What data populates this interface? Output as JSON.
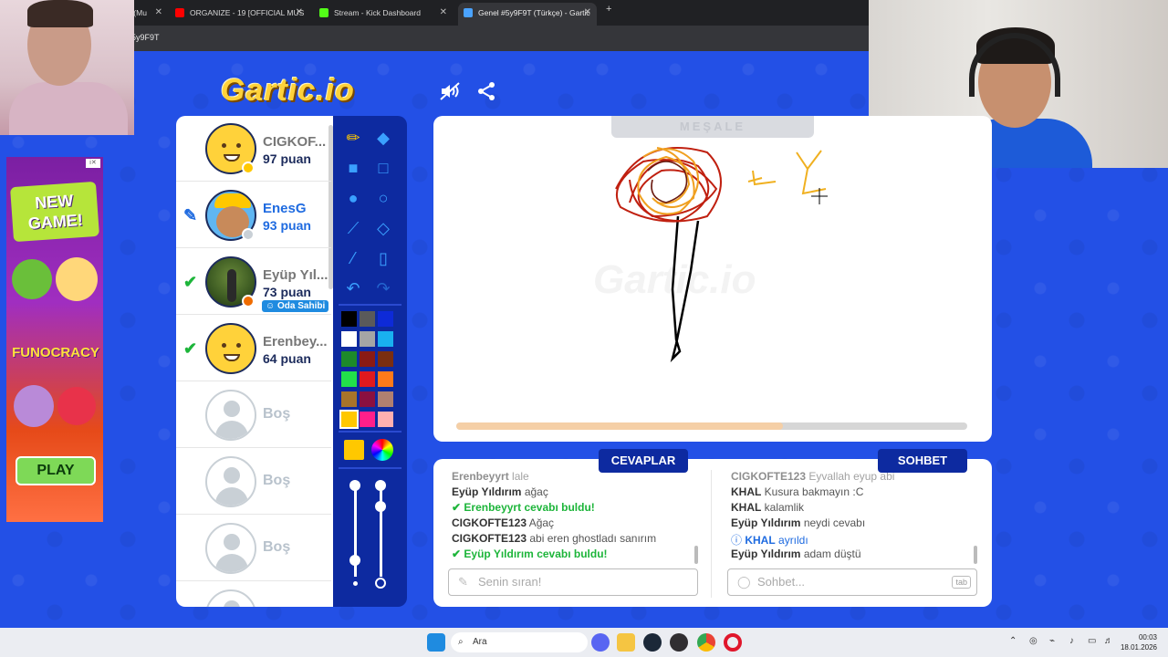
{
  "browser": {
    "tabs": [
      {
        "label": "YE BOYUN (Mu",
        "active": false,
        "favicon_color": "#d93025"
      },
      {
        "label": "ORGANIZE - 19 [OFFICIAL MUS",
        "active": false,
        "favicon_color": "#ff0000"
      },
      {
        "label": "Stream - Kick Dashboard",
        "active": false,
        "favicon_color": "#53fc18"
      },
      {
        "label": "Genel #5y9F9T (Türkçe) - Gartic",
        "active": true,
        "favicon_color": "#4aa3ff"
      }
    ],
    "url": "gartic.io/055y9F9T"
  },
  "logo": "Gartic.io",
  "players": [
    {
      "name": "CIGKOF...",
      "score": "97 puan",
      "avatar": "yellow",
      "status_color": "#ffc800",
      "mark": ""
    },
    {
      "name": "EnesG",
      "score": "93 puan",
      "avatar": "boy",
      "status_color": "#c9d0d6",
      "mark": "pencil",
      "is_drawer": true
    },
    {
      "name": "Eyüp Yıl...",
      "score": "73 puan",
      "avatar": "photo",
      "status_color": "#ef6c00",
      "mark": "check",
      "badge": "Oda Sahibi"
    },
    {
      "name": "Erenbey...",
      "score": "64 puan",
      "avatar": "yellow",
      "status_color": "",
      "mark": "check"
    }
  ],
  "empty_slot_label": "Boş",
  "empty_slots": 3,
  "tool_colors": [
    "#000000",
    "#5a5a5a",
    "#0d2ad8",
    "#ffffff",
    "#a5a5a5",
    "#19b0f0",
    "#1d8a2a",
    "#8a1a14",
    "#7a2e10",
    "#22e04a",
    "#e0191e",
    "#ff7a1a",
    "#a8742a",
    "#8a1040",
    "#b08070",
    "#ffc800",
    "#ff1f8a",
    "#ffb0b0"
  ],
  "selected_color": "#ffc800",
  "word_hint": "MEŞALE",
  "timer_progress": 0.64,
  "sections": {
    "answers": "CEVAPLAR",
    "chat": "SOHBET"
  },
  "answers": [
    {
      "user": "Erenbeyyrt",
      "text": "lale",
      "type": "faded"
    },
    {
      "user": "Eyüp Yıldırım",
      "text": "ağaç",
      "type": "normal"
    },
    {
      "user": "Erenbeyyrt",
      "text": "cevabı buldu!",
      "type": "hit"
    },
    {
      "user": "CIGKOFTE123",
      "text": "Ağaç",
      "type": "normal"
    },
    {
      "user": "CIGKOFTE123",
      "text": "abi eren ghostladı sanırım",
      "type": "normal"
    },
    {
      "user": "Eyüp Yıldırım",
      "text": "cevabı buldu!",
      "type": "hit"
    }
  ],
  "answers_placeholder": "Senin sıran!",
  "chat": [
    {
      "user": "CIGKOFTE123",
      "text": "Eyvallah eyup abi",
      "type": "faded"
    },
    {
      "user": "KHAL",
      "text": "Kusura bakmayın :C",
      "type": "normal"
    },
    {
      "user": "KHAL",
      "text": "kalamlik",
      "type": "normal"
    },
    {
      "user": "Eyüp Yıldırım",
      "text": "neydi cevabı",
      "type": "normal"
    },
    {
      "user": "KHAL",
      "text": "ayrıldı",
      "type": "leave"
    },
    {
      "user": "Eyüp Yıldırım",
      "text": "adam düştü",
      "type": "normal"
    }
  ],
  "chat_placeholder": "Sohbet...",
  "tab_key": "tab",
  "ad": {
    "new_game": "NEW GAME!",
    "funocracy": "FUNOCRACY",
    "play": "PLAY"
  },
  "taskbar": {
    "search": "Ara",
    "time": "00:03",
    "date": "18.01.2026"
  }
}
